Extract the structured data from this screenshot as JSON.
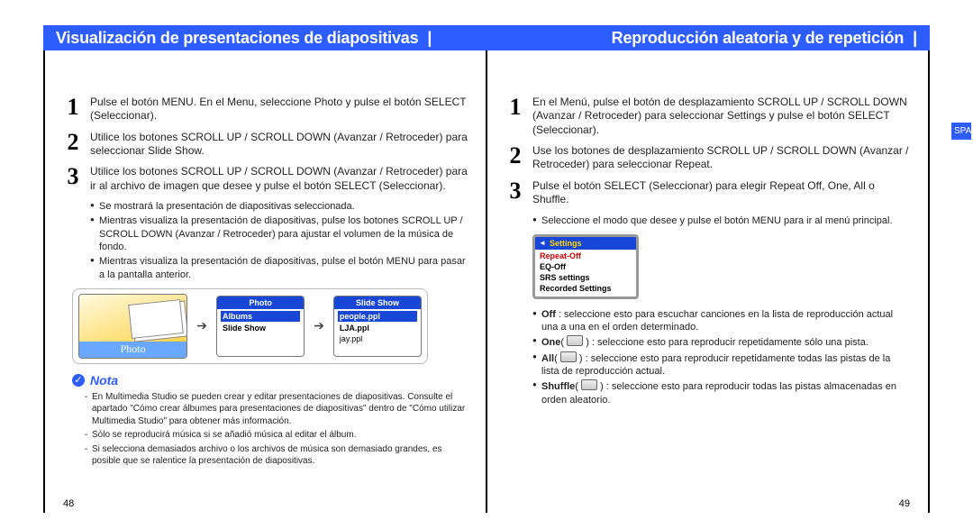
{
  "left": {
    "heading": "Visualización de presentaciones de diapositivas",
    "steps": [
      "Pulse el botón MENU.\nEn el Menu, seleccione Photo y pulse el botón SELECT (Seleccionar).",
      "Utilice los botones SCROLL UP / SCROLL DOWN (Avanzar / Retroceder) para seleccionar Slide Show.",
      "Utilice los botones SCROLL UP / SCROLL DOWN (Avanzar / Retroceder) para ir al archivo de imagen que desee y pulse el botón SELECT (Seleccionar)."
    ],
    "bullets": [
      "Se mostrará la presentación de diapositivas seleccionada.",
      "Mientras visualiza la presentación de diapositivas, pulse los botones SCROLL UP / SCROLL DOWN (Avanzar / Retroceder) para ajustar el volumen de la música de fondo.",
      "Mientras visualiza la presentación de diapositivas, pulse el botón MENU para pasar a la pantalla anterior."
    ],
    "screens": {
      "photo_label": "Photo",
      "menu2": {
        "title": "Photo",
        "hl": "Albums",
        "r2": "Slide Show"
      },
      "menu3": {
        "title": "Slide Show",
        "hl": "people.ppl",
        "r2": "LJA.ppl",
        "r3": "jay.ppl"
      }
    },
    "note_title": "Nota",
    "notes": [
      "En Multimedia Studio se pueden crear y editar presentaciones de diapositivas. Consulte el apartado \"Cómo crear álbumes para presentaciones de diapositivas\" dentro de \"Cómo utilizar Multimedia Studio\" para obtener más información.",
      "Sólo se reproducirá música si se añadió música al editar el álbum.",
      "Si selecciona demasiados archivo o los archivos de música son demasiado grandes, es posible que se ralentice la presentación de diapositivas."
    ],
    "pagenum": "48"
  },
  "right": {
    "heading": "Reproducción aleatoria y de repetición",
    "steps": [
      "En el Menú, pulse el botón de desplazamiento SCROLL UP / SCROLL DOWN (Avanzar / Retroceder) para seleccionar Settings y pulse el botón SELECT (Seleccionar).",
      "Use los botones de desplazamiento SCROLL UP / SCROLL DOWN (Avanzar / Retroceder) para seleccionar Repeat.",
      "Pulse el botón SELECT (Seleccionar) para elegir Repeat Off, One, All o Shuffle."
    ],
    "after3": "Seleccione el modo que desee y pulse el botón MENU para ir al menú principal.",
    "settings_screen": {
      "title": "Settings",
      "rows": [
        "Repeat-",
        "EQ-Off",
        "SRS settings",
        "Recorded Settings"
      ],
      "repeat_value": "Off"
    },
    "modes": [
      {
        "t": "Off",
        "d": " : seleccione esto para escuchar canciones en la lista de reproducción actual una a una en el orden determinado."
      },
      {
        "t": "One",
        "icon": true,
        "d": " : seleccione esto para reproducir repetidamente sólo una pista."
      },
      {
        "t": "All",
        "icon": true,
        "d": " : seleccione esto para reproducir repetidamente todas las pistas de la lista de reproducción actual."
      },
      {
        "t": "Shuffle",
        "icon": true,
        "d": " : seleccione esto para reproducir todas las pistas almacenadas en orden aleatorio."
      }
    ],
    "spa_tab": "SPA",
    "pagenum": "49"
  }
}
